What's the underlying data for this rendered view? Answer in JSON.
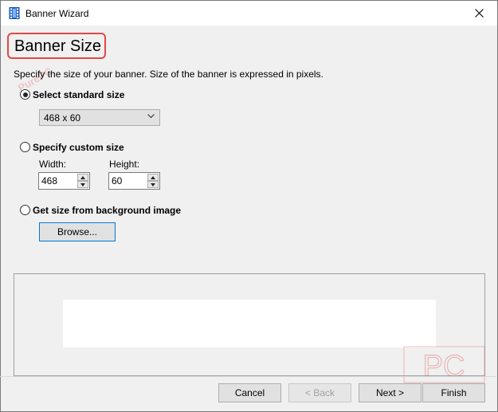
{
  "window": {
    "title": "Banner Wizard"
  },
  "heading": "Banner Size",
  "description": "Specify the size of your banner. Size of the banner is expressed in pixels.",
  "options": {
    "standard": {
      "label": "Select standard size",
      "selected": true,
      "value": "468 x 60"
    },
    "custom": {
      "label": "Specify custom size",
      "selected": false,
      "width_label": "Width:",
      "width_value": "468",
      "height_label": "Height:",
      "height_value": "60"
    },
    "background": {
      "label": "Get size from background image",
      "selected": false,
      "browse_label": "Browse..."
    }
  },
  "footer": {
    "cancel": "Cancel",
    "back": "< Back",
    "next": "Next >",
    "finish": "Finish"
  },
  "watermark": {
    "diagonal": "PurePC",
    "corner": "PC"
  },
  "colors": {
    "highlight": "#e04848",
    "focus": "#0078d7"
  }
}
